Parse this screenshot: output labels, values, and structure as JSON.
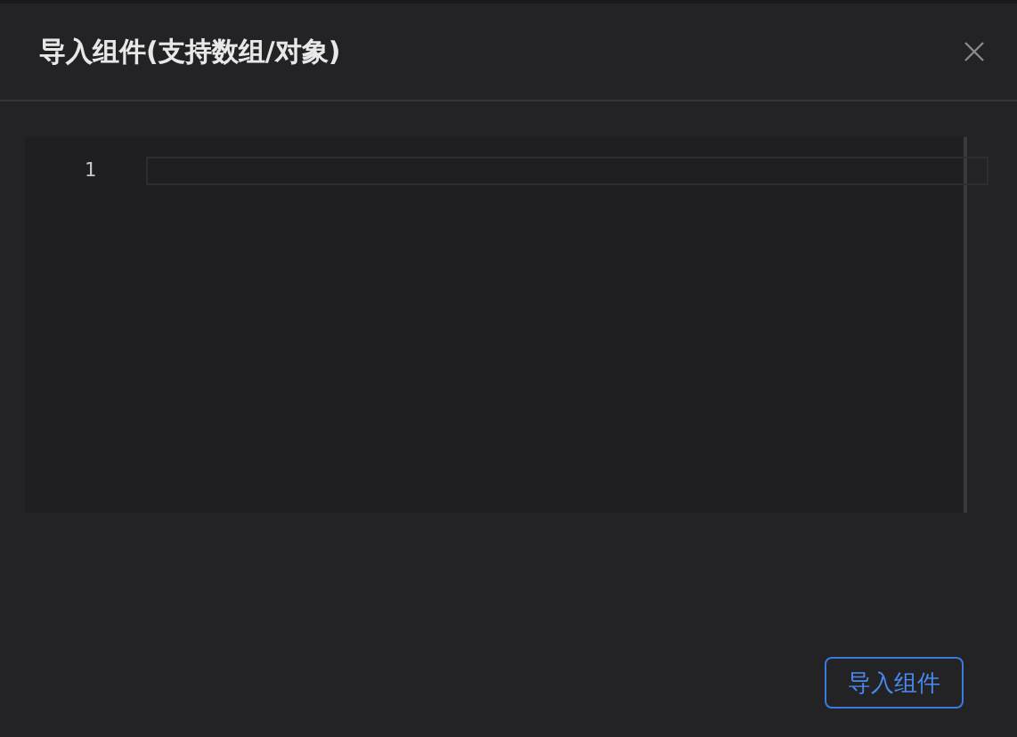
{
  "dialog": {
    "title": "导入组件(支持数组/对象)"
  },
  "editor": {
    "line_numbers": [
      "1"
    ]
  },
  "buttons": [
    {
      "label": "导入组件",
      "kind": "primary"
    }
  ]
}
